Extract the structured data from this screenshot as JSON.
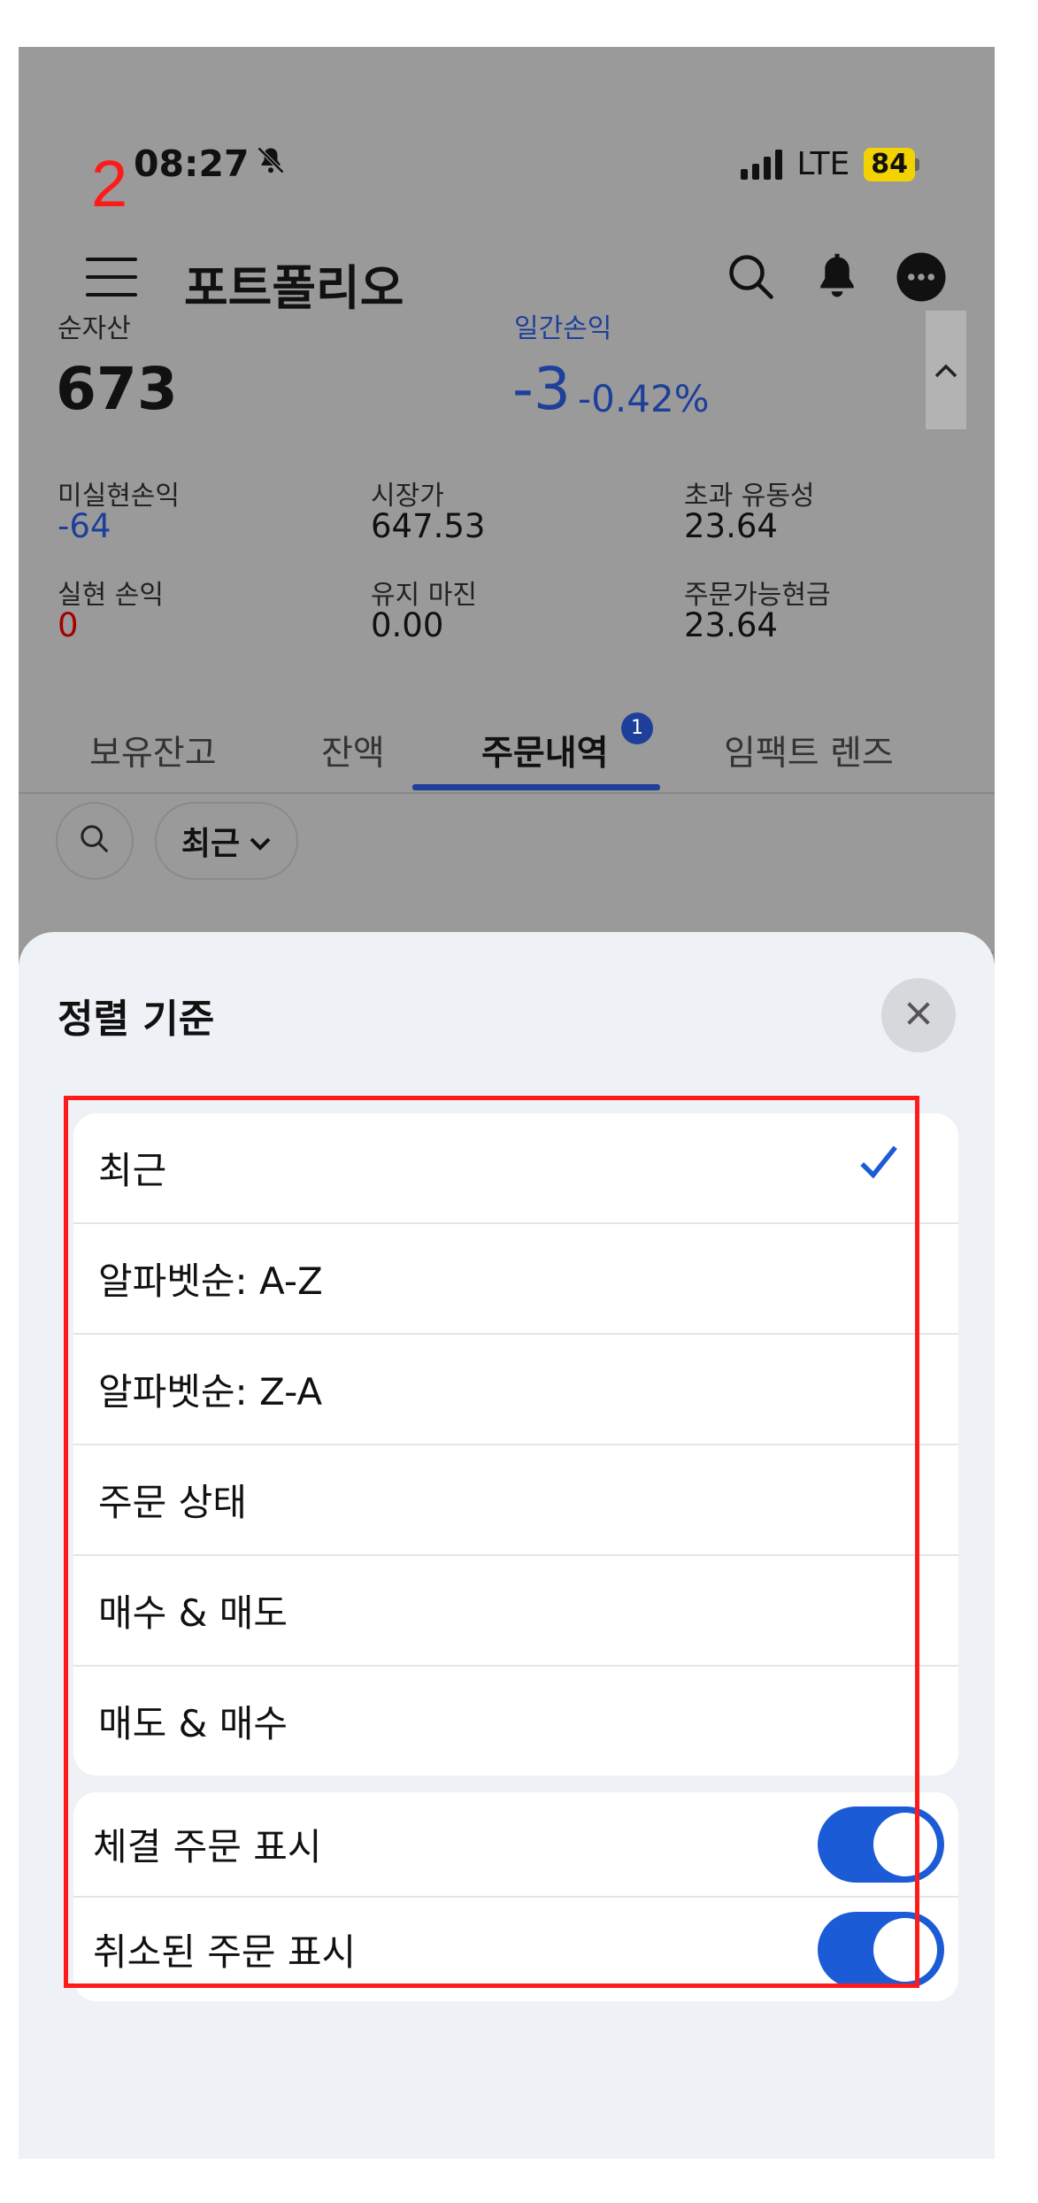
{
  "annotation": {
    "number": "2"
  },
  "status_bar": {
    "time": "08:27",
    "network": "LTE",
    "battery": "84"
  },
  "header": {
    "title": "포트폴리오"
  },
  "summary": {
    "net_assets": {
      "label": "순자산",
      "value": "673"
    },
    "daily_pl": {
      "label": "일간손익",
      "value": "-3",
      "percent": "-0.42%"
    }
  },
  "metrics": [
    {
      "label": "미실현손익",
      "value": "-64",
      "color": "#1e3f9a"
    },
    {
      "label": "시장가",
      "value": "647.53"
    },
    {
      "label": "초과 유동성",
      "value": "23.64"
    },
    {
      "label": "실현 손익",
      "value": "0",
      "color": "#a50000"
    },
    {
      "label": "유지 마진",
      "value": "0.00"
    },
    {
      "label": "주문가능현금",
      "value": "23.64"
    }
  ],
  "tabs": [
    {
      "label": "보유잔고"
    },
    {
      "label": "잔액"
    },
    {
      "label": "주문내역",
      "active": true,
      "badge": "1"
    },
    {
      "label": "임팩트 렌즈"
    }
  ],
  "filter": {
    "selected": "최근"
  },
  "sort_sheet": {
    "title": "정렬 기준",
    "options": [
      {
        "label": "최근",
        "selected": true
      },
      {
        "label": "알파벳순: A-Z"
      },
      {
        "label": "알파벳순: Z-A"
      },
      {
        "label": "주문 상태"
      },
      {
        "label": "매수 & 매도"
      },
      {
        "label": "매도 & 매수"
      }
    ],
    "toggles": [
      {
        "label": "체결 주문 표시",
        "on": true
      },
      {
        "label": "취소된 주문 표시",
        "on": true
      }
    ]
  },
  "colors": {
    "accent": "#1e3f9a",
    "toggle_on": "#1c5bd6",
    "highlight": "#ff1a1a",
    "negative": "#a50000"
  }
}
